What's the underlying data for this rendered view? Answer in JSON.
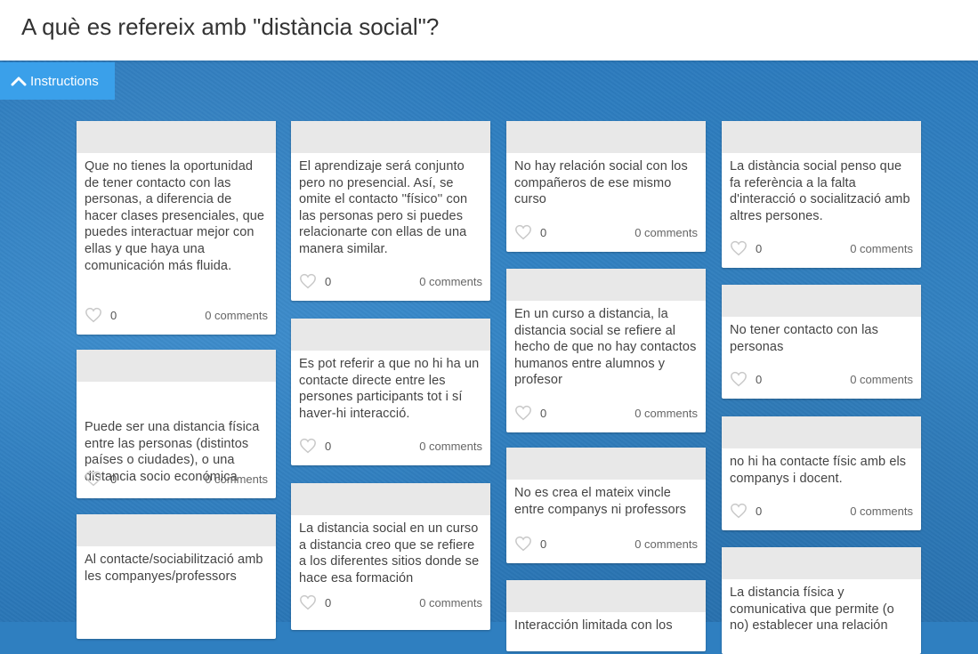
{
  "page": {
    "title": "A què es refereix amb \"distància social\"?"
  },
  "toolbar": {
    "instructions_label": "Instructions"
  },
  "cards": [
    {
      "text": "Que no tienes la oportunidad de tener contacto con las personas, a diferencia de hacer clases presenciales, que puedes interactuar mejor con ellas y que haya una comunicación más fluida.",
      "likes": "0",
      "comments": "0 comments"
    },
    {
      "text": "Puede ser una distancia física entre las personas (distintos países o ciudades), o una distancia socio económica",
      "likes": "0",
      "comments": "0 comments"
    },
    {
      "text": "Al contacte/sociabilització amb les companyes/professors",
      "likes": "0",
      "comments": "0 comments"
    },
    {
      "text": "El aprendizaje será conjunto pero no presencial. Así, se omite el contacto ''físico'' con las personas pero si puedes relacionarte con ellas de una manera similar.",
      "likes": "0",
      "comments": "0 comments"
    },
    {
      "text": "Es pot referir a que no hi ha un contacte directe entre les persones participants tot i sí haver-hi interacció.",
      "likes": "0",
      "comments": "0 comments"
    },
    {
      "text": "La distancia social en un curso a distancia creo que se refiere a los diferentes sitios donde se hace esa formación",
      "likes": "0",
      "comments": "0 comments"
    },
    {
      "text": "No hay relación social con los compañeros de ese mismo curso",
      "likes": "0",
      "comments": "0 comments"
    },
    {
      "text": "En un curso a distancia, la distancia social se refiere al hecho de que no hay contactos humanos entre alumnos y profesor",
      "likes": "0",
      "comments": "0 comments"
    },
    {
      "text": "No es crea el mateix vincle entre companys ni professors",
      "likes": "0",
      "comments": "0 comments"
    },
    {
      "text": "Interacción limitada con los",
      "likes": "",
      "comments": ""
    },
    {
      "text": "La distància social penso que fa referència a la falta d'interacció o socialització amb altres persones.",
      "likes": "0",
      "comments": "0 comments"
    },
    {
      "text": "No tener contacto con las personas",
      "likes": "0",
      "comments": "0 comments"
    },
    {
      "text": "no hi ha contacte físic amb els companys i docent.",
      "likes": "0",
      "comments": "0 comments"
    },
    {
      "text": "La distancia física y comunicativa que permite (o no) establecer una relación",
      "likes": "",
      "comments": ""
    }
  ]
}
